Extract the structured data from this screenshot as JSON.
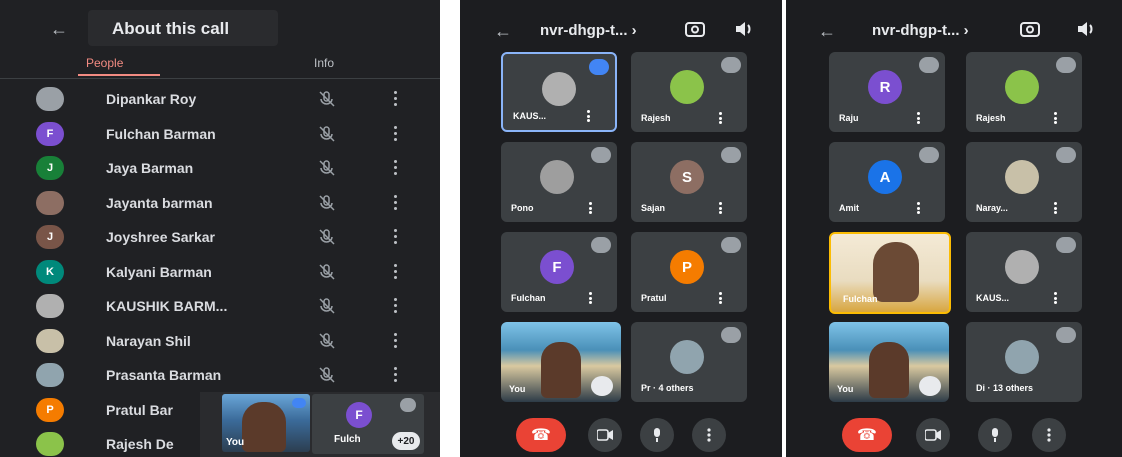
{
  "people_panel": {
    "title": "About this call",
    "tabs": [
      {
        "label": "People",
        "active": true
      },
      {
        "label": "Info",
        "active": false
      }
    ],
    "participants": [
      {
        "name": "Dipankar Roy",
        "initial": "",
        "avatar_color": "#9aa0a6"
      },
      {
        "name": "Fulchan Barman",
        "initial": "F",
        "avatar_color": "#7b4fd0"
      },
      {
        "name": "Jaya Barman",
        "initial": "J",
        "avatar_color": "#188038"
      },
      {
        "name": "Jayanta barman",
        "initial": "",
        "avatar_color": "#8d6e63"
      },
      {
        "name": "Joyshree Sarkar",
        "initial": "J",
        "avatar_color": "#795548"
      },
      {
        "name": "Kalyani Barman",
        "initial": "K",
        "avatar_color": "#00897b"
      },
      {
        "name": "KAUSHIK BARM...",
        "initial": "",
        "avatar_color": "#b0b0b0"
      },
      {
        "name": "Narayan Shil",
        "initial": "",
        "avatar_color": "#c8c0a8"
      },
      {
        "name": "Prasanta Barman",
        "initial": "",
        "avatar_color": "#90a4ae"
      },
      {
        "name": "Pratul Bar",
        "initial": "P",
        "avatar_color": "#f57c00"
      },
      {
        "name": "Rajesh De",
        "initial": "",
        "avatar_color": "#8bc34a"
      }
    ],
    "overlay": {
      "self_label": "You",
      "tile_initial": "F",
      "tile_name": "Fulch",
      "more_badge": "+20"
    }
  },
  "call_panel_left": {
    "meeting_code": "nvr-dhgp-t... ›",
    "tiles": [
      {
        "name": "KAUS...",
        "initial": "",
        "color": "#b0b0b0",
        "active": true
      },
      {
        "name": "Rajesh",
        "initial": "",
        "color": "#8bc34a",
        "active": false
      },
      {
        "name": "Pono",
        "initial": "",
        "color": "#9e9e9e",
        "active": false
      },
      {
        "name": "Sajan",
        "initial": "S",
        "color": "#8d6e63",
        "active": false
      },
      {
        "name": "Fulchan",
        "initial": "F",
        "color": "#7b4fd0",
        "active": false
      },
      {
        "name": "Pratul",
        "initial": "P",
        "color": "#f57c00",
        "active": false
      }
    ],
    "self_label": "You",
    "others_tile": {
      "name": "Pr · 4 others",
      "color": "#90a4ae"
    }
  },
  "call_panel_right": {
    "meeting_code": "nvr-dhgp-t... ›",
    "tiles": [
      {
        "name": "Raju",
        "initial": "R",
        "color": "#7b4fd0"
      },
      {
        "name": "Rajesh",
        "initial": "",
        "color": "#8bc34a"
      },
      {
        "name": "Amit",
        "initial": "A",
        "color": "#1a73e8"
      },
      {
        "name": "Naray...",
        "initial": "",
        "color": "#c8c0a8"
      },
      {
        "name": "KAUS...",
        "initial": "",
        "color": "#b0b0b0"
      }
    ],
    "video_person_label": "Fulchan",
    "self_label": "You",
    "others_tile": {
      "name": "Di · 13 others",
      "color": "#90a4ae"
    }
  },
  "colors": {
    "end_call": "#ea4335",
    "active_border": "#8ab4f8",
    "people_tab": "#f28b82"
  }
}
